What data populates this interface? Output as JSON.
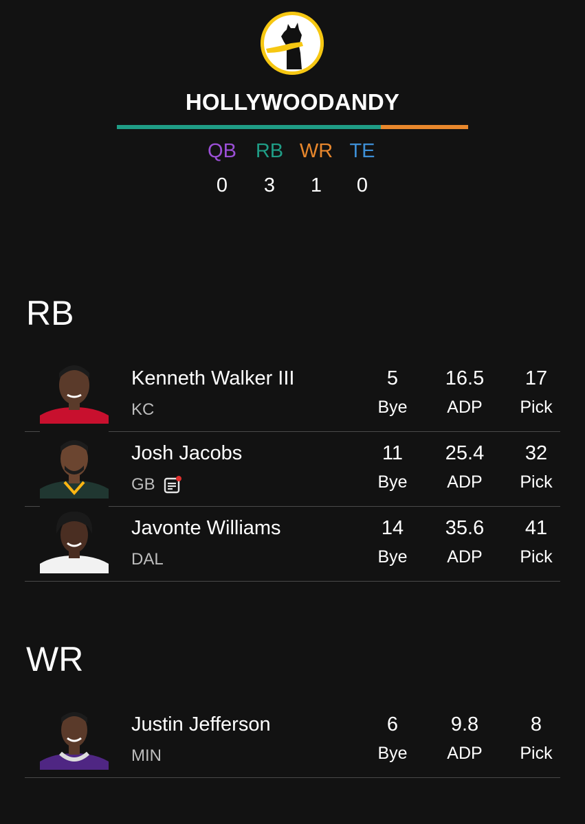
{
  "team": {
    "name": "HOLLYWOODANDY",
    "colors": {
      "logo_bg": "#f6c712",
      "bar_rb": "#1f9d86",
      "bar_wr": "#e8872c"
    }
  },
  "position_counts": [
    {
      "label": "QB",
      "count": "0",
      "color": "#9b4fd6"
    },
    {
      "label": "RB",
      "count": "3",
      "color": "#1f9d86"
    },
    {
      "label": "WR",
      "count": "1",
      "color": "#e8872c"
    },
    {
      "label": "TE",
      "count": "0",
      "color": "#3d8fd6"
    }
  ],
  "stat_labels": {
    "bye": "Bye",
    "adp": "ADP",
    "pick": "Pick"
  },
  "sections": [
    {
      "title": "RB",
      "players": [
        {
          "name": "Kenneth Walker III",
          "team": "KC",
          "bye": "5",
          "adp": "16.5",
          "pick": "17",
          "has_news": false,
          "jersey_color": "#c8102e"
        },
        {
          "name": "Josh Jacobs",
          "team": "GB",
          "bye": "11",
          "adp": "25.4",
          "pick": "32",
          "has_news": true,
          "jersey_color": "#203731"
        },
        {
          "name": "Javonte Williams",
          "team": "DAL",
          "bye": "14",
          "adp": "35.6",
          "pick": "41",
          "has_news": false,
          "jersey_color": "#f2f2f2"
        }
      ]
    },
    {
      "title": "WR",
      "players": [
        {
          "name": "Justin Jefferson",
          "team": "MIN",
          "bye": "6",
          "adp": "9.8",
          "pick": "8",
          "has_news": false,
          "jersey_color": "#4f2683"
        }
      ]
    }
  ]
}
